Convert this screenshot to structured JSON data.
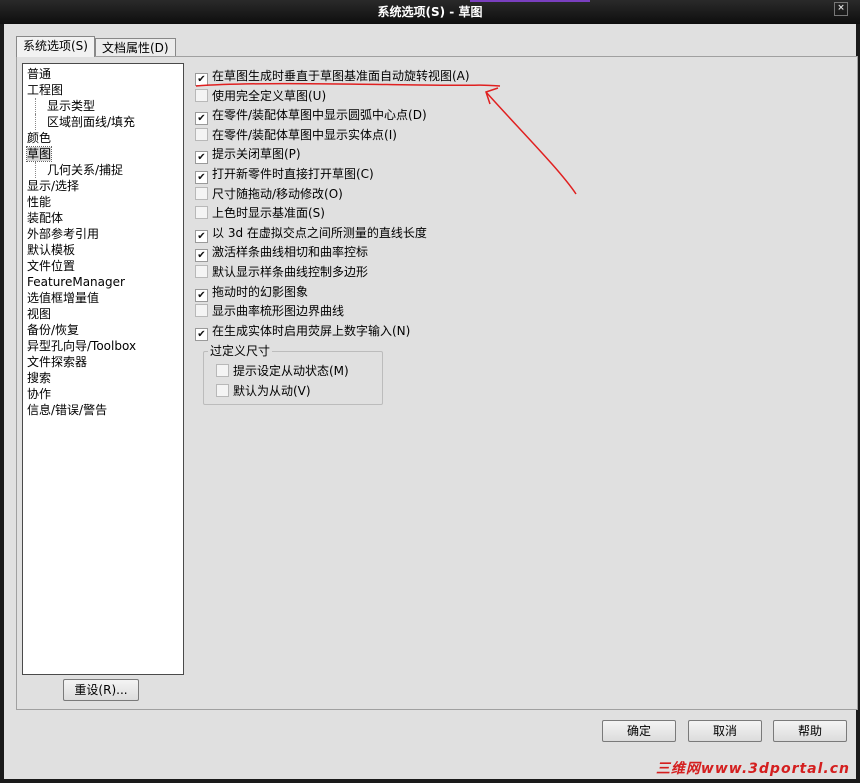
{
  "window": {
    "title": "系统选项(S) - 草图",
    "close_glyph": "×"
  },
  "tabs": [
    {
      "label": "系统选项(S)",
      "active": true
    },
    {
      "label": "文档属性(D)",
      "active": false
    }
  ],
  "tree": [
    {
      "label": "普通",
      "child": false
    },
    {
      "label": "工程图",
      "child": false
    },
    {
      "label": "显示类型",
      "child": true
    },
    {
      "label": "区域剖面线/填充",
      "child": true
    },
    {
      "label": "颜色",
      "child": false
    },
    {
      "label": "草图",
      "child": false,
      "selected": true
    },
    {
      "label": "几何关系/捕捉",
      "child": true
    },
    {
      "label": "显示/选择",
      "child": false
    },
    {
      "label": "性能",
      "child": false
    },
    {
      "label": "装配体",
      "child": false
    },
    {
      "label": "外部参考引用",
      "child": false
    },
    {
      "label": "默认模板",
      "child": false
    },
    {
      "label": "文件位置",
      "child": false
    },
    {
      "label": "FeatureManager",
      "child": false
    },
    {
      "label": "选值框增量值",
      "child": false
    },
    {
      "label": "视图",
      "child": false
    },
    {
      "label": "备份/恢复",
      "child": false
    },
    {
      "label": "异型孔向导/Toolbox",
      "child": false
    },
    {
      "label": "文件探索器",
      "child": false
    },
    {
      "label": "搜索",
      "child": false
    },
    {
      "label": "协作",
      "child": false
    },
    {
      "label": "信息/错误/警告",
      "child": false
    }
  ],
  "reset_button": "重设(R)...",
  "options": [
    {
      "label": "在草图生成时垂直于草图基准面自动旋转视图(A)",
      "checked": true
    },
    {
      "label": "使用完全定义草图(U)",
      "checked": false
    },
    {
      "label": "在零件/装配体草图中显示圆弧中心点(D)",
      "checked": true
    },
    {
      "label": "在零件/装配体草图中显示实体点(I)",
      "checked": false
    },
    {
      "label": "提示关闭草图(P)",
      "checked": true
    },
    {
      "label": "打开新零件时直接打开草图(C)",
      "checked": true
    },
    {
      "label": "尺寸随拖动/移动修改(O)",
      "checked": false
    },
    {
      "label": "上色时显示基准面(S)",
      "checked": false
    },
    {
      "label": "以 3d 在虚拟交点之间所测量的直线长度",
      "checked": true
    },
    {
      "label": "激活样条曲线相切和曲率控标",
      "checked": true
    },
    {
      "label": "默认显示样条曲线控制多边形",
      "checked": false
    },
    {
      "label": "拖动时的幻影图象",
      "checked": true
    },
    {
      "label": "显示曲率梳形图边界曲线",
      "checked": false
    },
    {
      "label": "在生成实体时启用荧屏上数字输入(N)",
      "checked": true
    }
  ],
  "overdefined_group": {
    "title": "过定义尺寸",
    "options": [
      {
        "label": "提示设定从动状态(M)",
        "checked": false
      },
      {
        "label": "默认为从动(V)",
        "checked": false
      }
    ]
  },
  "footer_buttons": {
    "ok": "确定",
    "cancel": "取消",
    "help": "帮助"
  },
  "checkmark_glyph": "✔",
  "annotation_color": "#e02020",
  "watermark": "三维网www.3dportal.cn"
}
